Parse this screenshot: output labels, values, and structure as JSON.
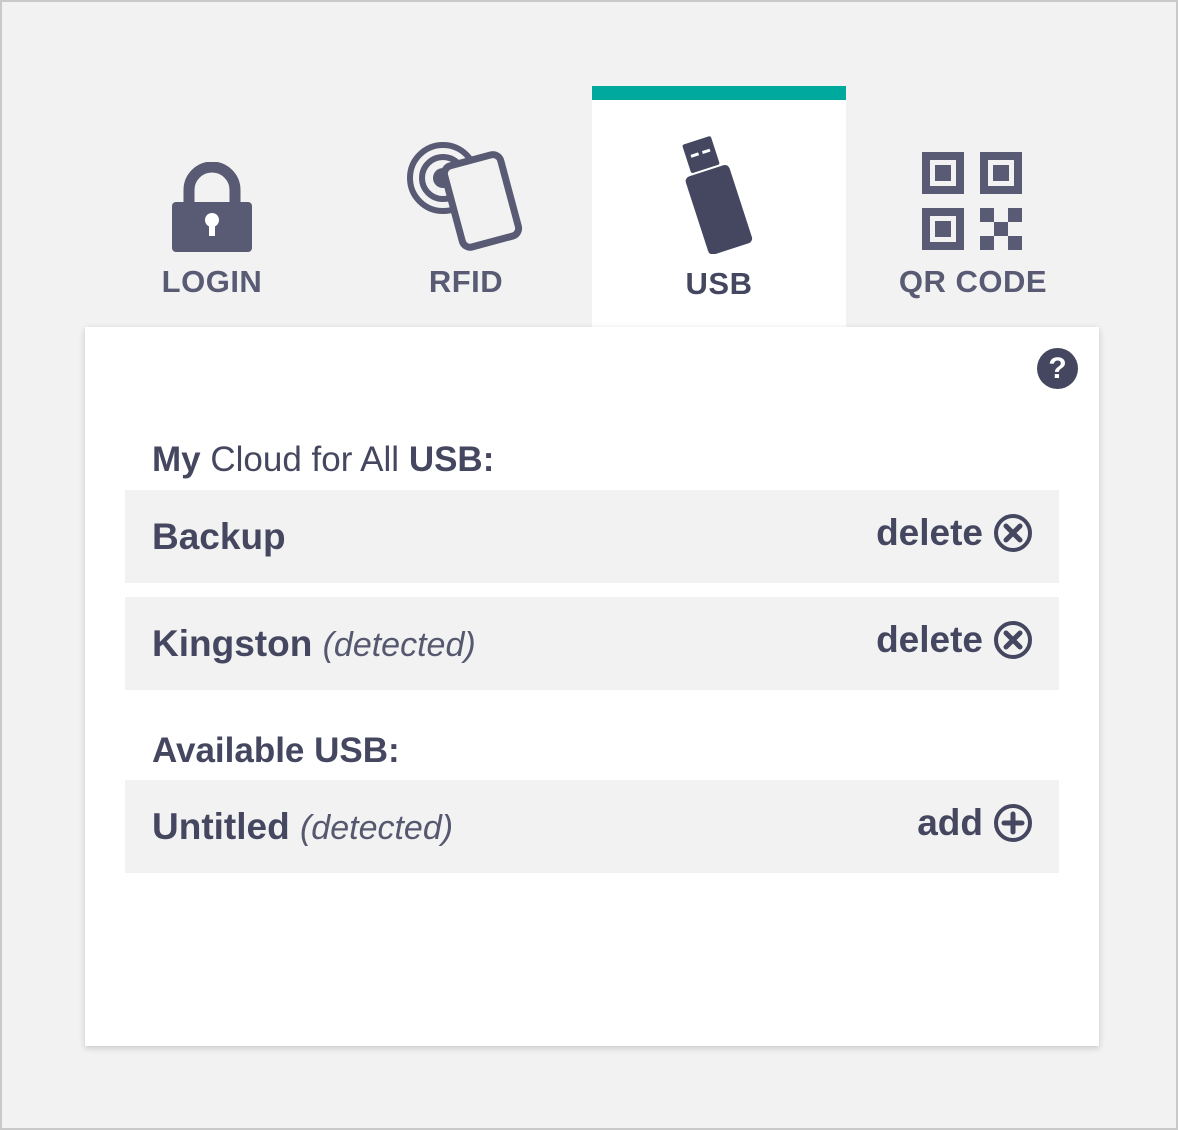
{
  "tabs": [
    {
      "label": "LOGIN",
      "icon": "lock-icon",
      "active": false
    },
    {
      "label": "RFID",
      "icon": "rfid-card-icon",
      "active": false
    },
    {
      "label": "USB",
      "icon": "usb-drive-icon",
      "active": true
    },
    {
      "label": "QR CODE",
      "icon": "qr-code-icon",
      "active": false
    }
  ],
  "colors": {
    "accent": "#00a99d",
    "text": "#44475f",
    "row_bg": "#f2f2f2"
  },
  "panel": {
    "help_label": "?",
    "my_section": {
      "prefix": "My",
      "middle": "Cloud for All",
      "suffix": "USB:"
    },
    "my_usb": [
      {
        "name": "Backup",
        "note": "",
        "action": "delete"
      },
      {
        "name": "Kingston",
        "note": "(detected)",
        "action": "delete"
      }
    ],
    "available_title": "Available USB:",
    "available_usb": [
      {
        "name": "Untitled",
        "note": "(detected)",
        "action": "add"
      }
    ]
  }
}
